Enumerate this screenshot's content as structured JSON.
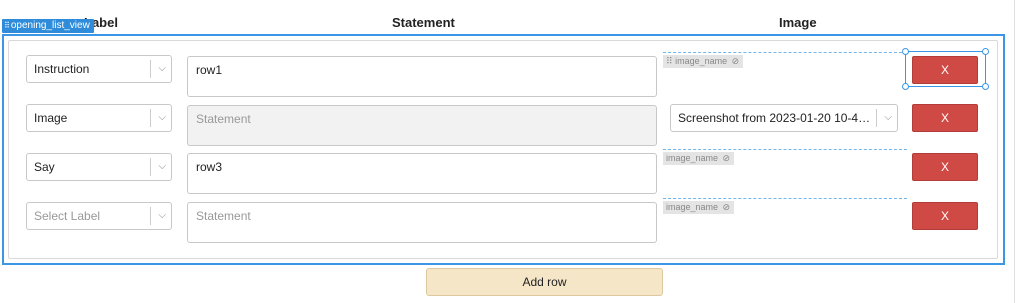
{
  "headers": {
    "label": "Label",
    "statement": "Statement",
    "image": "Image"
  },
  "list_view_tag": "opening_list_view",
  "rows": [
    {
      "label": "Instruction",
      "statement": "row1",
      "statement_placeholder": "Statement",
      "image_chip": "image_name",
      "delete_label": "X"
    },
    {
      "label": "Image",
      "statement": "",
      "statement_placeholder": "Statement",
      "image_select": "Screenshot from 2023-01-20 10-45...",
      "delete_label": "X"
    },
    {
      "label": "Say",
      "statement": "row3",
      "statement_placeholder": "Statement",
      "image_chip": "image_name",
      "delete_label": "X"
    },
    {
      "label": "",
      "label_placeholder": "Select Label",
      "statement": "",
      "statement_placeholder": "Statement",
      "image_chip": "image_name",
      "delete_label": "X"
    }
  ],
  "add_row_label": "Add row",
  "icons": {
    "chevron": "chevron-down-icon",
    "eye_hidden": "eye-off-icon",
    "grip": "drag-grip-icon"
  },
  "colors": {
    "delete_button": "#cf4a45",
    "add_row_button": "#f5e6c8",
    "selection": "#3b97e6"
  }
}
